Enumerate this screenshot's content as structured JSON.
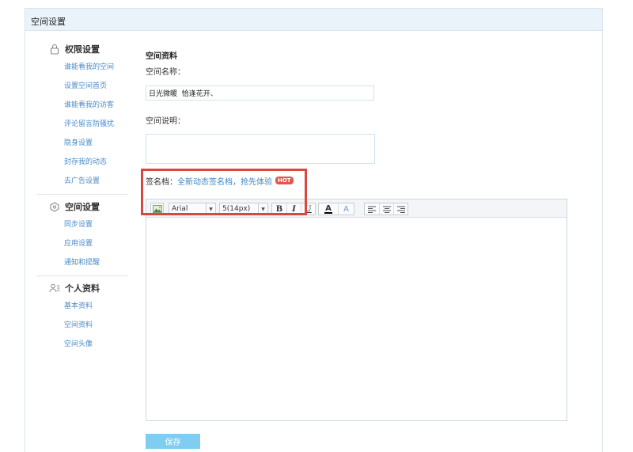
{
  "page": {
    "title": "空间设置"
  },
  "sidebar": {
    "sections": [
      {
        "title": "权限设置",
        "icon": "lock-icon",
        "items": [
          "谁能看我的空间",
          "设置空间首页",
          "谁能看我的访客",
          "评论留言防骚扰",
          "隐身设置",
          "封存我的动态",
          "去广告设置"
        ]
      },
      {
        "title": "空间设置",
        "icon": "space-icon",
        "items": [
          "同步设置",
          "应用设置",
          "通知和提醒"
        ]
      },
      {
        "title": "个人资料",
        "icon": "user-profile-icon",
        "items": [
          "基本资料",
          "空间资料",
          "空间头像"
        ]
      }
    ]
  },
  "form": {
    "heading": "空间资料",
    "name_label": "空间名称：",
    "name_value": "日光微暖  恰逢花开、",
    "desc_label": "空间说明：",
    "desc_value": "",
    "signature_label": "签名档：",
    "signature_link": "全新动态签名档，抢先体验",
    "hot_badge": "HOT",
    "save_label": "保存"
  },
  "editor": {
    "font": "Arial",
    "size": "5(14px)",
    "bold": "B",
    "italic": "I",
    "underline": "U",
    "font_color": "A",
    "text_effect": "A"
  },
  "colors": {
    "accent": "#3b86c6",
    "highlight_border": "#d9473e",
    "hot_badge": "#e4554e",
    "save_button": "#7fcdf0",
    "header_bg": "#eaf3fa"
  }
}
